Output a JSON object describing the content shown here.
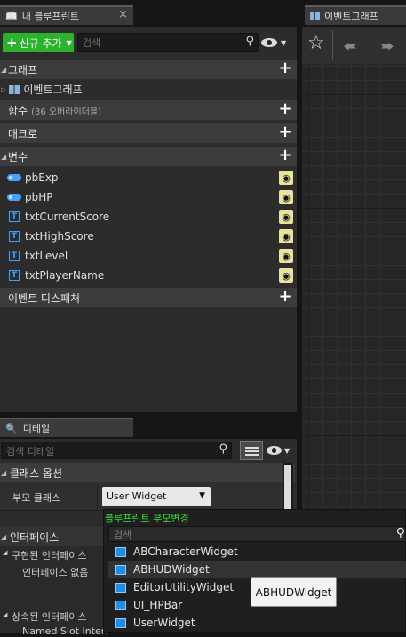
{
  "blueprint_tab": {
    "title": "내 블루프린트"
  },
  "event_graph_tab": {
    "title": "이벤트그래프"
  },
  "toolbar": {
    "new_add_label": "신규 추가",
    "search_placeholder": "검색"
  },
  "categories": {
    "graph": "그래프",
    "event_graph_item": "이벤트그래프",
    "functions": "함수",
    "functions_count": "(36 오버라이더블)",
    "macros": "매크로",
    "variables": "변수",
    "event_dispatchers": "이벤트 디스패처"
  },
  "variables": [
    {
      "name": "pbExp",
      "type": "bool-icon"
    },
    {
      "name": "pbHP",
      "type": "bool-icon"
    },
    {
      "name": "txtCurrentScore",
      "type": "text-icon"
    },
    {
      "name": "txtHighScore",
      "type": "text-icon"
    },
    {
      "name": "txtLevel",
      "type": "text-icon"
    },
    {
      "name": "txtPlayerName",
      "type": "text-icon"
    }
  ],
  "details_tab": {
    "title": "디테일"
  },
  "details": {
    "search_placeholder": "검색 디테일",
    "class_options": "클래스 옵션",
    "parent_class_label": "부모 클래스",
    "parent_class_value": "User Widget",
    "interfaces": "인터페이스",
    "implemented_interfaces": "구현된 인터페이스",
    "no_interfaces": "인터페이스 없음",
    "inherited_interfaces": "상속된 인터페이스",
    "named_slot": "Named Slot Interf"
  },
  "parent_picker": {
    "title": "블루프린트 부모변경",
    "search_placeholder": "검색",
    "items": [
      "ABCharacterWidget",
      "ABHUDWidget",
      "EditorUtilityWidget",
      "UI_HPBar",
      "UserWidget"
    ],
    "tooltip": "ABHUDWidget"
  },
  "colors": {
    "accent_green": "#2db22d",
    "picker_title": "#3ce03c",
    "eye_badge": "#e9e3a0",
    "class_icon": "#1e8de6"
  }
}
